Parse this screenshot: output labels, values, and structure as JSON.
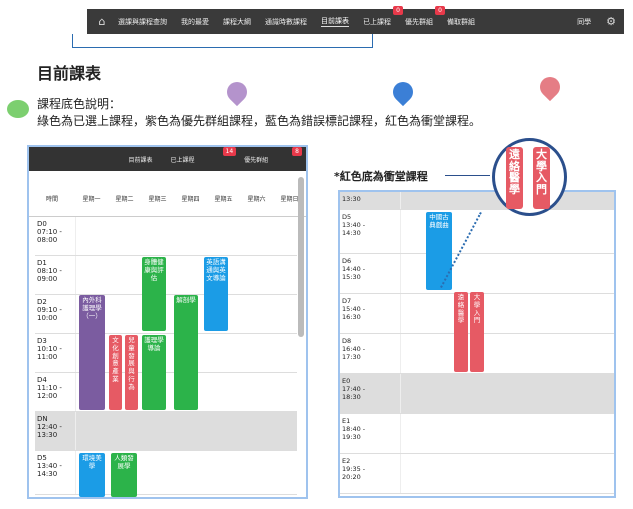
{
  "nav": {
    "items": [
      "選課與課程查詢",
      "我的最愛",
      "課程大綱",
      "通識時數課程",
      "目前課表",
      "已上課程",
      "優先群組",
      "備取群組"
    ],
    "badge_taken": "0",
    "badge_priority": "0",
    "user": "同學"
  },
  "heading": "目前課表",
  "desc_label": "課程底色說明：",
  "desc_text": "綠色為已選上課程，紫色為優先群組課程，藍色為錯誤標記課程，紅色為衝堂課程。",
  "panel1": {
    "bar": {
      "current": "目前課表",
      "taken": "已上課程",
      "taken_badge": "14",
      "priority": "優先群組",
      "priority_badge": "8"
    },
    "headers": [
      "時間",
      "星期一",
      "星期二",
      "星期三",
      "星期四",
      "星期五",
      "星期六",
      "星期日"
    ],
    "rows": [
      {
        "t": "D0\n07:10 -\n08:00"
      },
      {
        "t": "D1\n08:10 -\n09:00"
      },
      {
        "t": "D2\n09:10 -\n10:00"
      },
      {
        "t": "D3\n10:10 -\n11:00"
      },
      {
        "t": "D4\n11:10 -\n12:00"
      },
      {
        "t": "DN\n12:40 -\n13:30"
      },
      {
        "t": "D5\n13:40 -\n14:30"
      }
    ],
    "courses": [
      "身體健康與評估",
      "英語溝通與英文導論",
      "內外科護理學（一）",
      "解剖學",
      "文化創意產業",
      "兒童發展與行為",
      "護理學導論",
      "環境美學",
      "人類發展學"
    ]
  },
  "note": "*紅色底為衝堂課程",
  "zoom": {
    "c1": "遠絡醫學",
    "c2": "大學入門"
  },
  "panel2": {
    "rows": [
      "13:30",
      "D5\n13:40 -\n14:30",
      "D6\n14:40 -\n15:30",
      "D7\n15:40 -\n16:30",
      "D8\n16:40 -\n17:30",
      "E0\n17:40 -\n18:30",
      "E1\n18:40 -\n19:30",
      "E2\n19:35 -\n20:20"
    ],
    "courses": [
      "中國古典戲曲",
      "遠絡醫學",
      "大學入門"
    ]
  }
}
